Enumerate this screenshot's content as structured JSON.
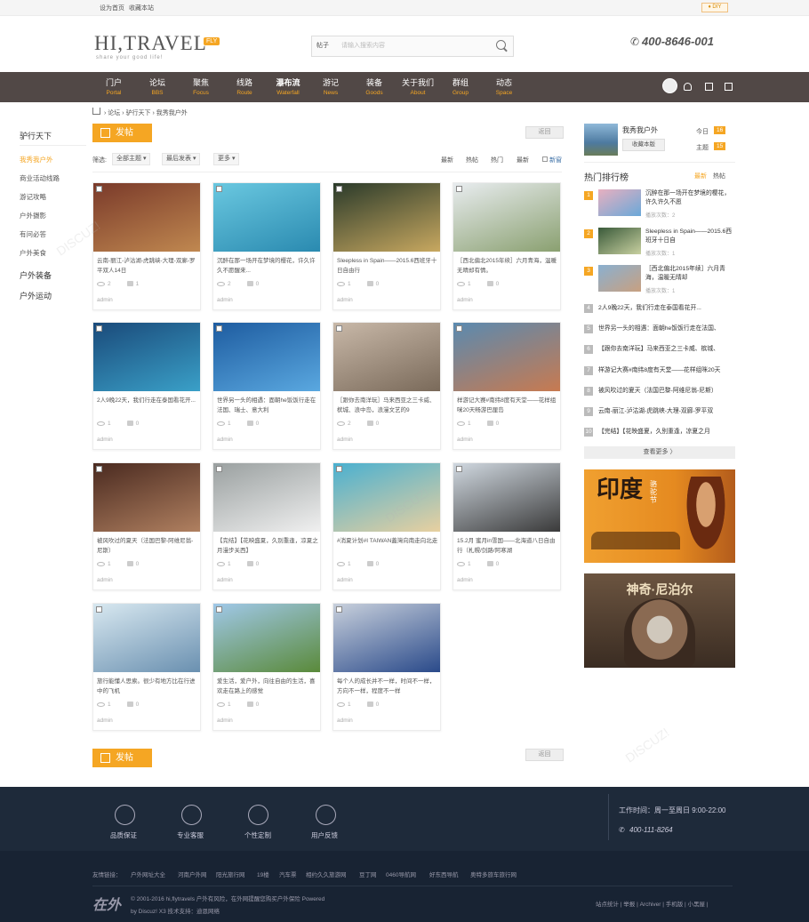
{
  "topbar": {
    "set_home": "设为首页",
    "bookmark": "收藏本站",
    "diy": "♦ DIY"
  },
  "header": {
    "logo": "HI,TRAVEL",
    "logo_badge": "FLY",
    "tagline": "share your good life!",
    "search_scope": "帖子",
    "search_placeholder": "请输入搜索内容",
    "phone": "400-8646-001"
  },
  "nav": [
    {
      "cn": "门户",
      "en": "Portal"
    },
    {
      "cn": "论坛",
      "en": "BBS"
    },
    {
      "cn": "聚焦",
      "en": "Focus"
    },
    {
      "cn": "线路",
      "en": "Route"
    },
    {
      "cn": "瀑布流",
      "en": "Waterfall"
    },
    {
      "cn": "游记",
      "en": "News"
    },
    {
      "cn": "装备",
      "en": "Goods"
    },
    {
      "cn": "关于我们",
      "en": "About"
    },
    {
      "cn": "群组",
      "en": "Group"
    },
    {
      "cn": "动态",
      "en": "Space"
    }
  ],
  "breadcrumb": "› 论坛 › 驴行天下 › 我秀我户外",
  "left_nav": {
    "title": "驴行天下",
    "items": [
      "我秀我户外",
      "商业活动线路",
      "游记攻略",
      "户外摄影",
      "有问必答",
      "户外美食"
    ],
    "section2": "户外装备",
    "section3": "户外运动"
  },
  "post_button": "发帖",
  "back_button": "返回",
  "filter": {
    "label": "筛选:",
    "sel1": "全部主题 ▾",
    "sel2": "最后发表 ▾",
    "sel3": "更多 ▾",
    "tabs": [
      "最新",
      "热帖",
      "热门",
      "最新"
    ],
    "new_window": "新窗"
  },
  "cards": [
    {
      "title": "云南-丽江-泸沽湖-虎跳峡-大理-双廊-罗平双人14日",
      "views": "2",
      "replies": "1",
      "author": "admin"
    },
    {
      "title": "沉醉在那一场开在梦境的樱花，许久许久不愿醒来...",
      "views": "2",
      "replies": "0",
      "author": "admin"
    },
    {
      "title": "Sleepless in Spain——2015.6西班牙十日自由行",
      "views": "1",
      "replies": "0",
      "author": "admin"
    },
    {
      "title": "［西北偏北2015年续］六月青海，温暖无晴却有情。",
      "views": "1",
      "replies": "0",
      "author": "admin"
    },
    {
      "title": "2人9晚22天，我们行走在泰国看花开...",
      "views": "1",
      "replies": "0",
      "author": "admin"
    },
    {
      "title": "世界另一头的相遇：面朝he饭饭行走在法国、瑞士、意大利",
      "views": "1",
      "replies": "0",
      "author": "admin"
    },
    {
      "title": "［跟你去南洋玩］马来西亚之三卡威、槟城、浪中岛，浪漫文艺的9",
      "views": "2",
      "replies": "0",
      "author": "admin"
    },
    {
      "title": "样游记大赛#南纬8度有天堂——花样组咪20天畅游巴厘岛",
      "views": "1",
      "replies": "0",
      "author": "admin"
    },
    {
      "title": "被风吹过的夏天（法国巴黎-阿维尼翁-尼斯）",
      "views": "1",
      "replies": "0",
      "author": "admin"
    },
    {
      "title": "【完结】【花映盛夏，久别重逢，凉夏之月漫步关西】",
      "views": "1",
      "replies": "0",
      "author": "admin"
    },
    {
      "title": "#消夏计划#I TAIWAN蓋灣向南走向北走",
      "views": "1",
      "replies": "0",
      "author": "admin"
    },
    {
      "title": "15.2月 蜜月in雪国——北海道八日自由行（札幌/剑路/阿寒湖",
      "views": "1",
      "replies": "0",
      "author": "admin"
    },
    {
      "title": "旅行能懂人思索。很少有地方比在行进中的飞机",
      "views": "1",
      "replies": "0",
      "author": "admin"
    },
    {
      "title": "爱生活，爱户外，向往自由的生活，喜欢走在路上的感觉",
      "views": "1",
      "replies": "0",
      "author": "admin"
    },
    {
      "title": "每个人的成长并不一样，时间不一样，方向不一样，程度不一样",
      "views": "1",
      "replies": "0",
      "author": "admin"
    }
  ],
  "sidebar": {
    "forum": {
      "name": "我秀我户外",
      "fav_button": "收藏本版",
      "today_label": "今日",
      "today": "16",
      "topics_label": "主题",
      "topics": "15"
    },
    "rank_title": "热门排行榜",
    "rank_tabs": [
      "最新",
      "热帖"
    ],
    "rank": [
      {
        "n": "1",
        "title": "沉醉在那一场开在梦境的樱花，许久许久不愿",
        "views": "播放次数：2"
      },
      {
        "n": "2",
        "title": "Sleepless in Spain——2015.6西班牙十日自",
        "views": "播放次数：1"
      },
      {
        "n": "3",
        "title": "［西北偏北2015年续］六月青海，温暖无晴却",
        "views": "播放次数：1"
      },
      {
        "n": "4",
        "title": "2人9晚22天，我们行走在泰国看花开..."
      },
      {
        "n": "5",
        "title": "世界另一头的相遇：面朝he饭饭行走在法国、"
      },
      {
        "n": "6",
        "title": "【跟你去南洋玩】马来西亚之三卡威、槟城、"
      },
      {
        "n": "7",
        "title": "样游记大赛#南纬8度有天堂——花样组咪20天"
      },
      {
        "n": "8",
        "title": "被风吹过的夏天（法国巴黎-阿维尼翁-尼斯）"
      },
      {
        "n": "9",
        "title": "云南-丽江-泸沽湖-虎跳峡-大理-双廊-罗平双"
      },
      {
        "n": "10",
        "title": "【完结】【花映盛夏，久别重逢，凉夏之月"
      }
    ],
    "more": "查看更多 〉",
    "ad1": {
      "title": "印度",
      "sub": "骆驼节"
    },
    "ad2": {
      "title": "神奇·尼泊尔"
    }
  },
  "footer": {
    "features": [
      "品质保证",
      "专业客服",
      "个性定制",
      "用户反馈"
    ],
    "hours": "工作时间：周一至周日 9:00-22:00",
    "phone": "400-111-8264",
    "links_label": "友情链接：",
    "links": [
      "户外网址大全",
      "河南户外网",
      "阳光旅行网",
      "19楼",
      "汽车票",
      "相约久久旅游网",
      "豆丁网",
      "0460导航网",
      "好东西导航",
      "奥特多旅车旅行网"
    ],
    "logo": "在外",
    "copy1": "© 2001-2016 hi,flytravels 户外有风险，在外网提醒您购买户外保险 Powered",
    "copy2": "by Discuz! X3  技术支持：迪恩网络",
    "right": "站点统计 | 举报 | Archiver | 手机版 | 小黑屋 |"
  }
}
